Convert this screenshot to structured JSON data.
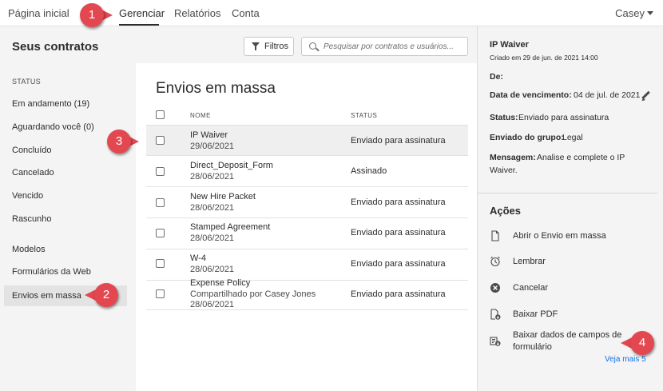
{
  "topnav": {
    "items": [
      "Página inicial",
      "Gerenciar",
      "Relatórios",
      "Conta"
    ],
    "active": "Gerenciar",
    "user": "Casey"
  },
  "header": {
    "title": "Seus contratos",
    "filter_label": "Filtros",
    "search_placeholder": "Pesquisar por contratos e usuários..."
  },
  "sidebar": {
    "status_heading": "STATUS",
    "status_items": [
      "Em andamento (19)",
      "Aguardando você (0)",
      "Concluído",
      "Cancelado",
      "Vencido",
      "Rascunho"
    ],
    "other_items": [
      "Modelos",
      "Formulários da Web",
      "Envios em massa"
    ],
    "selected": "Envios em massa"
  },
  "list": {
    "title": "Envios em massa",
    "columns": [
      "NOME",
      "STATUS"
    ],
    "rows": [
      {
        "name": "IP Waiver",
        "sub": "",
        "date": "29/06/2021",
        "status": "Enviado para assinatura"
      },
      {
        "name": "Direct_Deposit_Form",
        "sub": "",
        "date": "28/06/2021",
        "status": "Assinado"
      },
      {
        "name": "New Hire Packet",
        "sub": "",
        "date": "28/06/2021",
        "status": "Enviado para assinatura"
      },
      {
        "name": "Stamped Agreement",
        "sub": "",
        "date": "28/06/2021",
        "status": "Enviado para assinatura"
      },
      {
        "name": "W-4",
        "sub": "",
        "date": "28/06/2021",
        "status": "Enviado para assinatura"
      },
      {
        "name": "Expense Policy",
        "sub": "Compartilhado por Casey Jones",
        "date": "28/06/2021",
        "status": "Enviado para assinatura"
      }
    ]
  },
  "details": {
    "title": "IP Waiver",
    "created": "Criado em 29 de jun. de 2021 14:00",
    "de_label": "De:",
    "due_label": "Data de vencimento:",
    "due_value": "04 de jul. de 2021",
    "status_label": "Status:",
    "status_value": "Enviado para assinatura",
    "group_label": "Enviado do grupo:",
    "group_value": "Legal",
    "message_label": "Mensagem:",
    "message_value_1": "Analise e complete o IP",
    "message_value_2": "Waiver."
  },
  "actions": {
    "heading": "Ações",
    "items": [
      "Abrir o Envio em massa",
      "Lembrar",
      "Cancelar",
      "Baixar PDF",
      "Baixar dados de campos de",
      "formulário"
    ],
    "see_more": "Veja mais 5"
  },
  "callouts": [
    "1",
    "2",
    "3",
    "4"
  ],
  "colors": {
    "callout": "#e34850",
    "link": "#1473e6"
  }
}
